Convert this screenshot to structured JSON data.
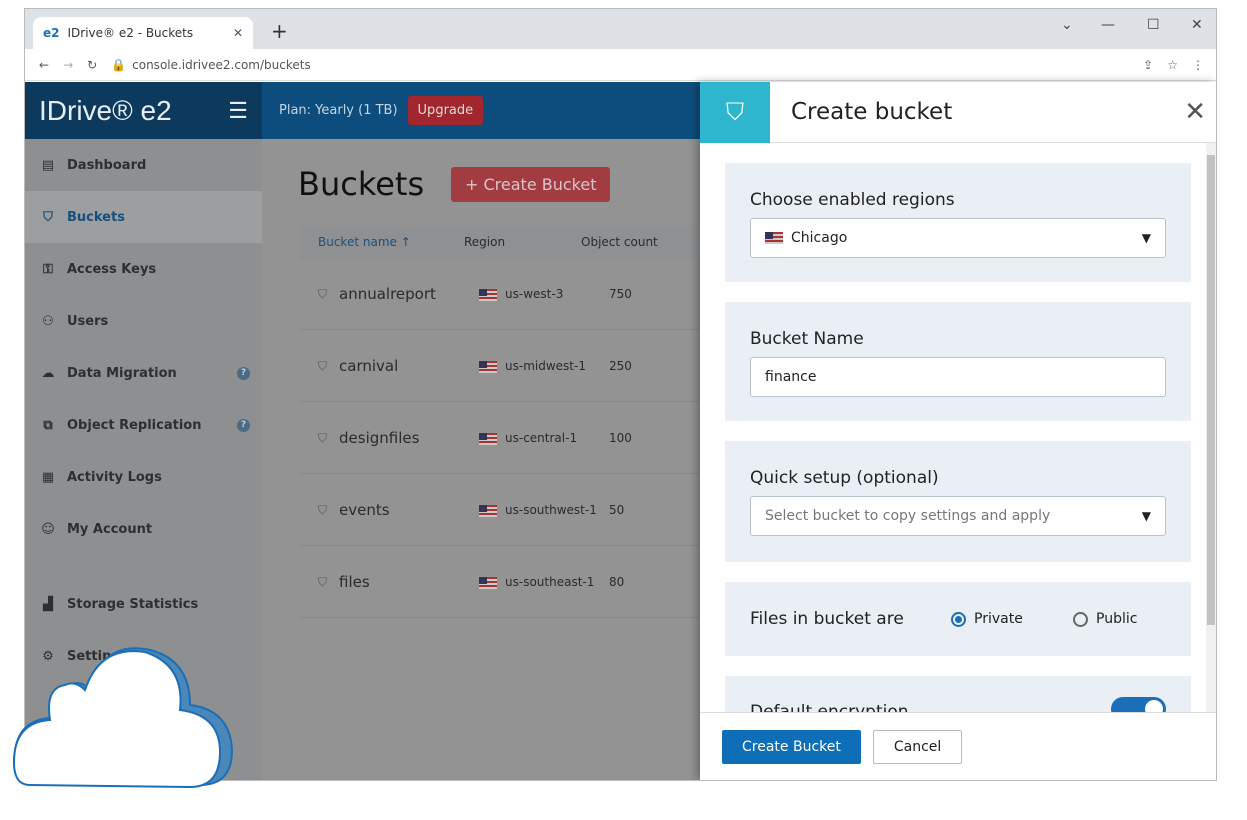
{
  "browser": {
    "tab_title": "IDrive® e2 - Buckets",
    "favicon": "e2",
    "url": "console.idrivee2.com/buckets"
  },
  "sidebar": {
    "logo": "IDrive® e2",
    "items": [
      {
        "label": "Dashboard",
        "icon": "dashboard-icon"
      },
      {
        "label": "Buckets",
        "icon": "bucket-icon",
        "active": true
      },
      {
        "label": "Access Keys",
        "icon": "key-icon"
      },
      {
        "label": "Users",
        "icon": "users-icon"
      },
      {
        "label": "Data Migration",
        "icon": "cloud-migration-icon",
        "help": true
      },
      {
        "label": "Object Replication",
        "icon": "replication-icon",
        "help": true
      },
      {
        "label": "Activity Logs",
        "icon": "logs-icon"
      },
      {
        "label": "My Account",
        "icon": "user-icon"
      },
      {
        "label": "Storage Statistics",
        "icon": "chart-icon"
      },
      {
        "label": "Settings",
        "icon": "gear-icon"
      }
    ]
  },
  "topbar": {
    "plan": "Plan: Yearly (1 TB)",
    "upgrade": "Upgrade"
  },
  "main": {
    "title": "Buckets",
    "create_label": "+  Create Bucket",
    "columns": [
      "Bucket name ↑",
      "Region",
      "Object count"
    ],
    "rows": [
      {
        "name": "annualreport",
        "region": "us-west-3",
        "count": "750"
      },
      {
        "name": "carnival",
        "region": "us-midwest-1",
        "count": "250"
      },
      {
        "name": "designfiles",
        "region": "us-central-1",
        "count": "100"
      },
      {
        "name": "events",
        "region": "us-southwest-1",
        "count": "50"
      },
      {
        "name": "files",
        "region": "us-southeast-1",
        "count": "80"
      }
    ]
  },
  "panel": {
    "title": "Create bucket",
    "regions_label": "Choose enabled regions",
    "region_value": "Chicago",
    "name_label": "Bucket Name",
    "name_value": "finance",
    "quick_label": "Quick setup (optional)",
    "quick_placeholder": "Select bucket to copy settings and apply",
    "files_label": "Files in bucket are",
    "private": "Private",
    "public": "Public",
    "encryption_label": "Default encryption",
    "create": "Create Bucket",
    "cancel": "Cancel"
  }
}
